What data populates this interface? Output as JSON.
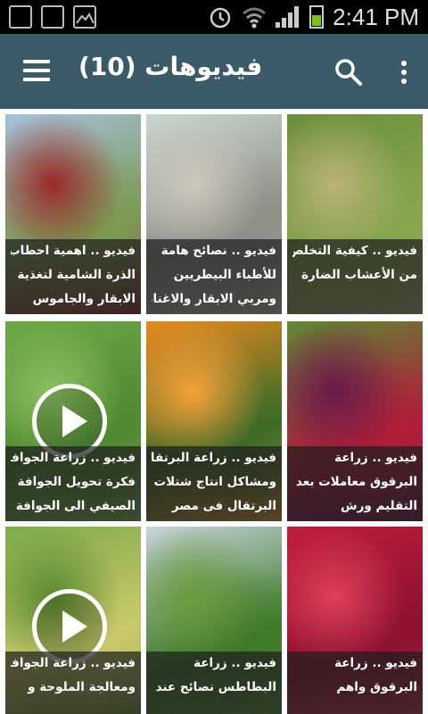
{
  "status_bar": {
    "time": "2:41 PM",
    "left_icons": [
      "sd-card-icon",
      "sd-card-icon",
      "image-icon"
    ],
    "right_icons": [
      "alarm-icon",
      "wifi-icon",
      "signal-icon",
      "battery-icon"
    ]
  },
  "app_bar": {
    "title": "فيديوهات (10)",
    "menu_icon": "hamburger-menu-icon",
    "search_icon": "search-icon",
    "more_icon": "more-vert-icon",
    "color": "#3c5b68"
  },
  "videos": [
    {
      "line1": "فيديو .. كيفية التخلص",
      "line2": "من الأعشاب الضارة",
      "line3": "",
      "play": false,
      "colors": [
        "#6d8f3c",
        "#86a54d",
        "#b9b27a"
      ]
    },
    {
      "line1": "فيديو .. نصائح هامة",
      "line2": "للأطباء البيطريين",
      "line3": "ومربي الابقار والاغنام",
      "play": false,
      "colors": [
        "#c9d6cf",
        "#8f8f88",
        "#ccc6ba"
      ]
    },
    {
      "line1": "فيديو .. اهمية احطاب",
      "line2": "الذرة الشامية لتغذية",
      "line3": "الابقار والجاموس",
      "play": false,
      "colors": [
        "#a6c0dc",
        "#7c9a54",
        "#9a2a2a"
      ]
    },
    {
      "line1": "فيديو .. زراعة",
      "line2": "البرقوق معاملات بعد",
      "line3": "التقليم ورش",
      "play": false,
      "colors": [
        "#5f8a35",
        "#b01f3a",
        "#6a1a4a"
      ]
    },
    {
      "line1": "فيديو .. زراعة البرتقال",
      "line2": "ومشاكل انتاج شتلات",
      "line3": "البرتقال فى مصر",
      "play": false,
      "colors": [
        "#e8891f",
        "#3f6c28",
        "#f5a13a"
      ]
    },
    {
      "line1": "فيديو .. زراعة الجوافة",
      "line2": "فكرة تحويل الجوافة",
      "line3": "الصيفي الى الجوافة",
      "play": true,
      "colors": [
        "#6da845",
        "#4f8a32",
        "#8cc061"
      ]
    },
    {
      "line1": "فيديو .. زراعة",
      "line2": "البرقوق واهم",
      "line3": "",
      "play": false,
      "colors": [
        "#c01d3d",
        "#8d1230",
        "#e0405a"
      ]
    },
    {
      "line1": "فيديو .. زراعة",
      "line2": "البطاطس نصائح عند",
      "line3": "",
      "play": false,
      "colors": [
        "#c8d4dc",
        "#3f7a2a",
        "#6b9a3e"
      ]
    },
    {
      "line1": "فيديو .. زراعة الجوافة",
      "line2": "ومعالجة الملوحة و",
      "line3": "",
      "play": true,
      "colors": [
        "#7fab4a",
        "#c8c86a",
        "#5a8a30"
      ]
    }
  ]
}
